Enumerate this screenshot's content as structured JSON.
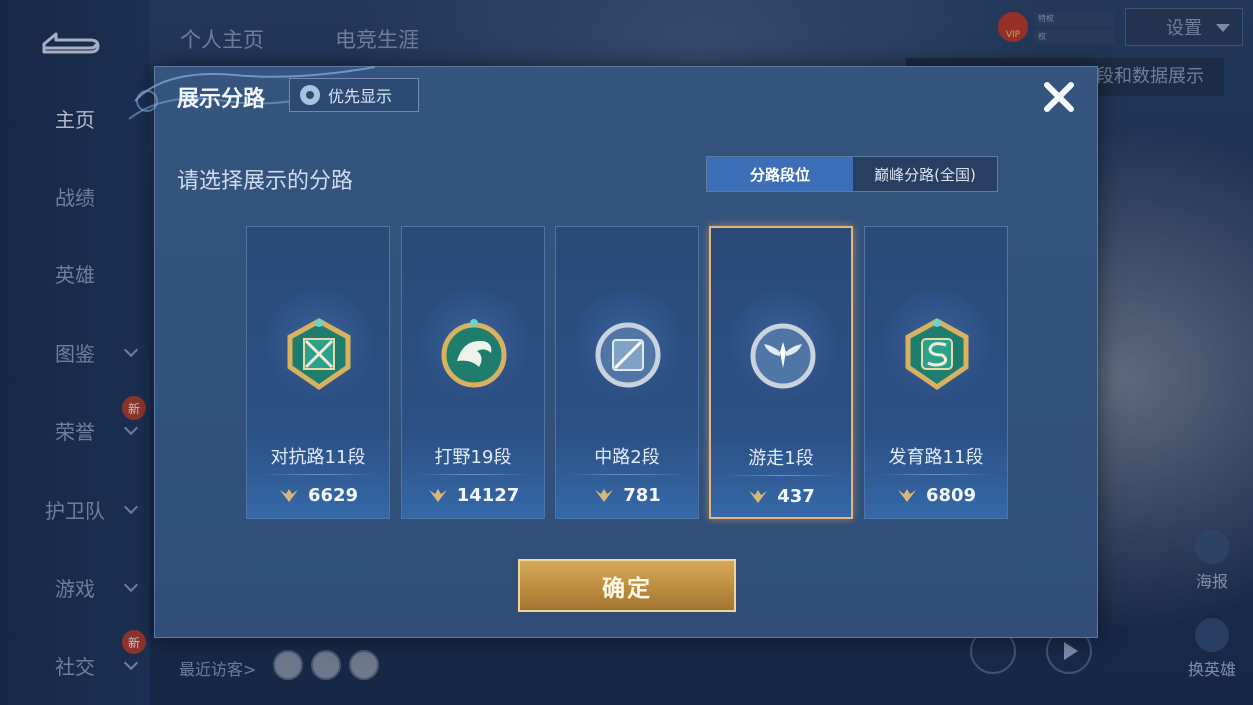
{
  "background": {
    "top_tabs": [
      "个人主页",
      "电竞生涯"
    ],
    "settings_label": "设置",
    "behind_text": "段和数据展示",
    "vip_label": "VIP",
    "tags": [
      "特权",
      "权"
    ],
    "sidebar": {
      "items": [
        {
          "label": "主页",
          "active": true,
          "chevron": false
        },
        {
          "label": "战绩",
          "active": false,
          "chevron": false
        },
        {
          "label": "英雄",
          "active": false,
          "chevron": false
        },
        {
          "label": "图鉴",
          "active": false,
          "chevron": true
        },
        {
          "label": "荣誉",
          "active": false,
          "chevron": true,
          "new": true
        },
        {
          "label": "护卫队",
          "active": false,
          "chevron": true
        },
        {
          "label": "游戏",
          "active": false,
          "chevron": true
        },
        {
          "label": "社交",
          "active": false,
          "chevron": true,
          "new": true
        }
      ],
      "new_badge_label": "新"
    },
    "recent_visitors_label": "最近访客>",
    "right_buttons": [
      {
        "label": "海报",
        "icon": "poster-icon"
      },
      {
        "label": "换英雄",
        "icon": "swap-hero-icon"
      }
    ]
  },
  "modal": {
    "title": "展示分路",
    "priority_label": "优先显示",
    "subtitle": "请选择展示的分路",
    "segments": [
      {
        "label": "分路段位",
        "active": true
      },
      {
        "label": "巅峰分路(全国)",
        "active": false
      }
    ],
    "cards": [
      {
        "rank": "对抗路11段",
        "score": "6629",
        "badge": "clash-lane-badge-icon",
        "selected": false,
        "theme": "gold-teal"
      },
      {
        "rank": "打野19段",
        "score": "14127",
        "badge": "jungle-dragon-badge-icon",
        "selected": false,
        "theme": "gold-teal"
      },
      {
        "rank": "中路2段",
        "score": "781",
        "badge": "mid-lane-badge-icon",
        "selected": false,
        "theme": "silver-blue"
      },
      {
        "rank": "游走1段",
        "score": "437",
        "badge": "roam-wings-badge-icon",
        "selected": true,
        "theme": "silver-blue"
      },
      {
        "rank": "发育路11段",
        "score": "6809",
        "badge": "farm-lane-badge-icon",
        "selected": false,
        "theme": "gold-teal"
      }
    ],
    "confirm_label": "确定"
  },
  "colors": {
    "accent_gold": "#e7b47a",
    "segment_active": "#3c6fb8",
    "modal_bg": "#35557f"
  }
}
